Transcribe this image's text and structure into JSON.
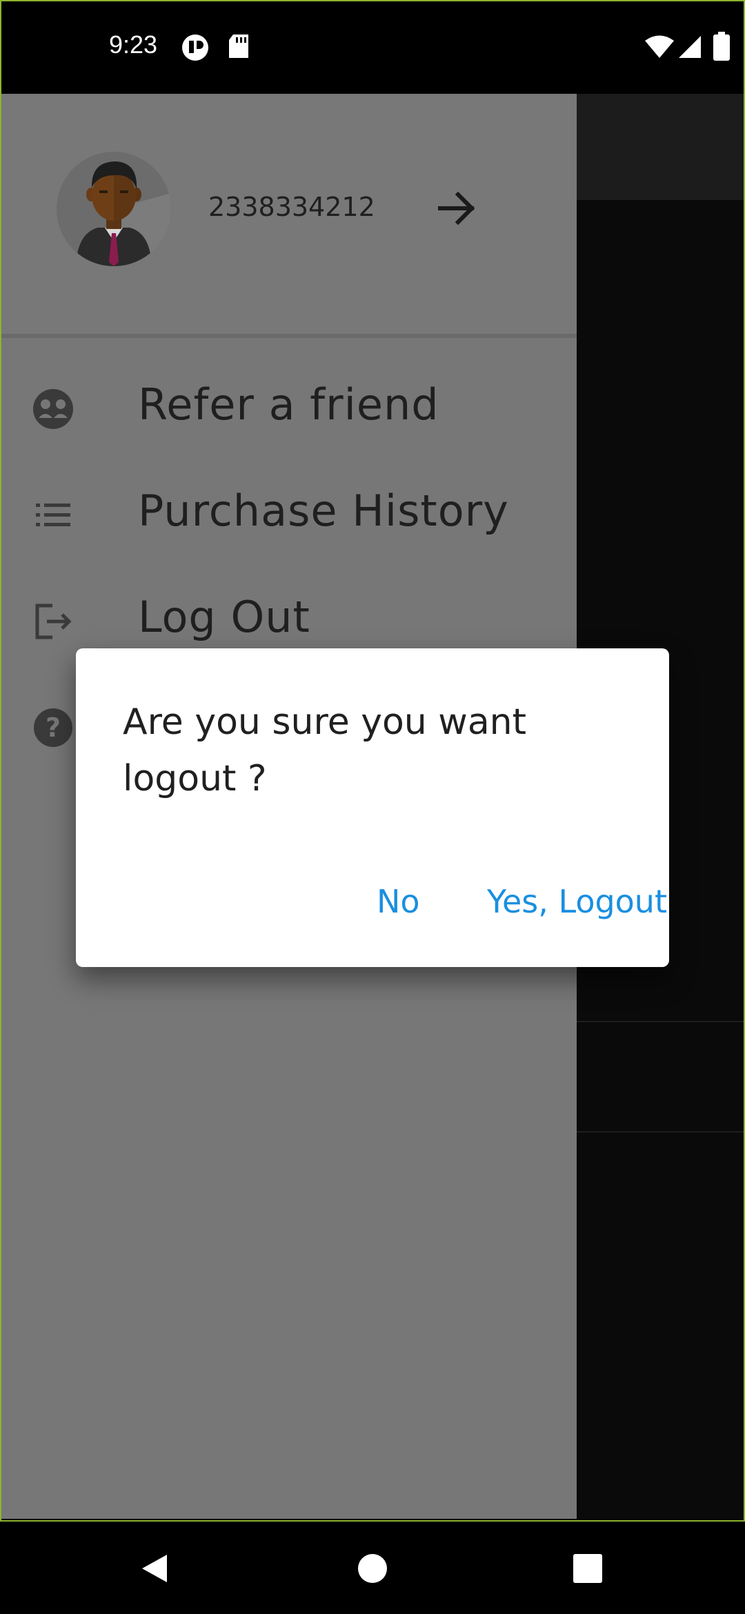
{
  "status_bar": {
    "time": "9:23",
    "icons": [
      "notification-app-icon",
      "sd-card-icon",
      "wifi-icon",
      "cellular-signal-icon",
      "battery-icon"
    ]
  },
  "drawer": {
    "header": {
      "phone_number": "2338334212",
      "avatar_icon": "businessman-avatar-icon",
      "arrow_icon": "arrow-right-icon"
    },
    "items": [
      {
        "label": "Refer a friend",
        "icon": "refer-friend-icon"
      },
      {
        "label": "Purchase History",
        "icon": "list-icon"
      },
      {
        "label": "Log Out",
        "icon": "logout-icon"
      },
      {
        "label": "",
        "icon": "help-icon"
      }
    ]
  },
  "dialog": {
    "message": "Are you sure you want logout ?",
    "negative_label": "No",
    "positive_label": "Yes, Logout",
    "accent_color": "#1a8fe0"
  },
  "nav_bar": {
    "icons": [
      "back-icon",
      "home-icon",
      "recents-icon"
    ]
  },
  "colors": {
    "drawer_bg": "#777777",
    "scrim": "#000000",
    "frame_outline": "#8db32f"
  }
}
